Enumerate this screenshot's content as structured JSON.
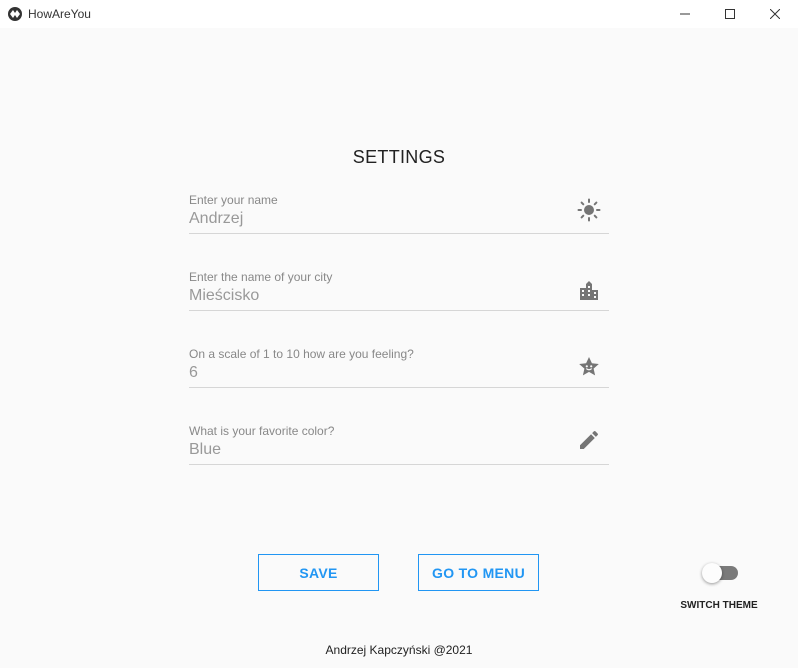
{
  "window": {
    "title": "HowAreYou"
  },
  "page": {
    "title": "SETTINGS"
  },
  "fields": [
    {
      "label": "Enter your name",
      "value": "Andrzej",
      "icon": "brightness-icon"
    },
    {
      "label": "Enter the name of your city",
      "value": "Mieścisko",
      "icon": "city-icon"
    },
    {
      "label": "On a scale of 1 to 10 how are you feeling?",
      "value": "6",
      "icon": "star-face-icon"
    },
    {
      "label": "What is your favorite color?",
      "value": "Blue",
      "icon": "pencil-icon"
    }
  ],
  "buttons": {
    "save": "SAVE",
    "menu": "GO TO MENU"
  },
  "theme_switch": {
    "label": "SWITCH THEME",
    "on": false
  },
  "footer": {
    "text": "Andrzej Kapczyński @2021"
  },
  "colors": {
    "accent": "#2196f3",
    "background": "#fafafa",
    "icon": "#757575"
  }
}
